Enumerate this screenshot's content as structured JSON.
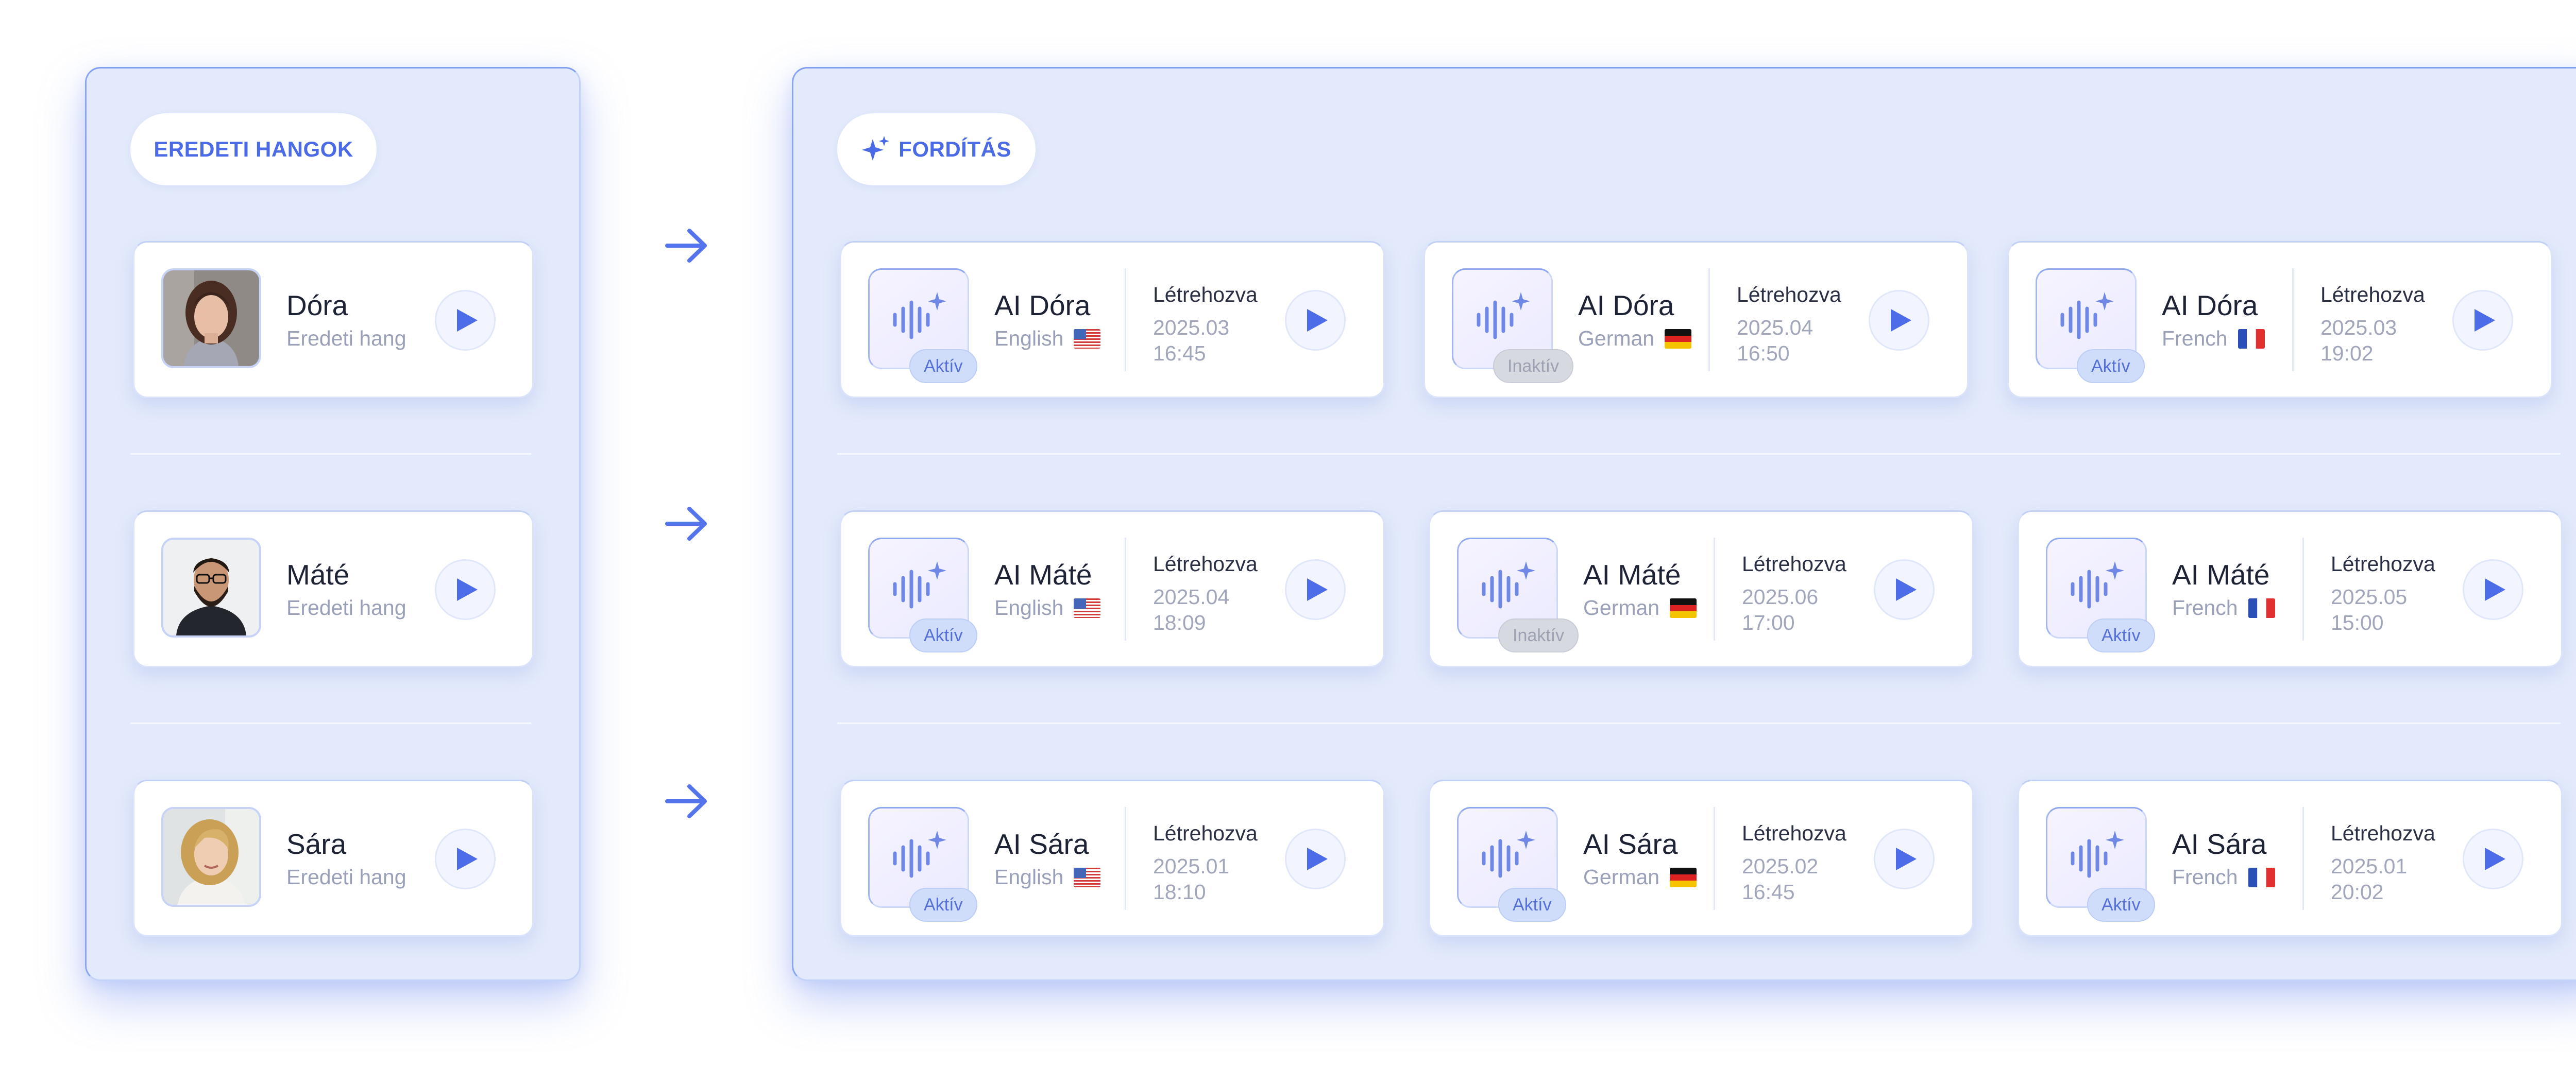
{
  "left_panel": {
    "heading": "EREDETI HANGOK",
    "voices": [
      {
        "name": "Dóra",
        "subtitle": "Eredeti hang"
      },
      {
        "name": "Máté",
        "subtitle": "Eredeti hang"
      },
      {
        "name": "Sára",
        "subtitle": "Eredeti hang"
      }
    ]
  },
  "right_panel": {
    "heading": "FORDÍTÁS",
    "created_label": "Létrehozva",
    "rows": [
      [
        {
          "name": "AI Dóra",
          "language": "English",
          "flag": "us",
          "date": "2025.03",
          "time": "16:45",
          "status": "Aktív"
        },
        {
          "name": "AI Dóra",
          "language": "German",
          "flag": "de",
          "date": "2025.04",
          "time": "16:50",
          "status": "Inaktív"
        },
        {
          "name": "AI Dóra",
          "language": "French",
          "flag": "fr",
          "date": "2025.03",
          "time": "19:02",
          "status": "Aktív"
        }
      ],
      [
        {
          "name": "AI Máté",
          "language": "English",
          "flag": "us",
          "date": "2025.04",
          "time": "18:09",
          "status": "Aktív"
        },
        {
          "name": "AI Máté",
          "language": "German",
          "flag": "de",
          "date": "2025.06",
          "time": "17:00",
          "status": "Inaktív"
        },
        {
          "name": "AI Máté",
          "language": "French",
          "flag": "fr",
          "date": "2025.05",
          "time": "15:00",
          "status": "Aktív"
        }
      ],
      [
        {
          "name": "AI Sára",
          "language": "English",
          "flag": "us",
          "date": "2025.01",
          "time": "18:10",
          "status": "Aktív"
        },
        {
          "name": "AI Sára",
          "language": "German",
          "flag": "de",
          "date": "2025.02",
          "time": "16:45",
          "status": "Aktív"
        },
        {
          "name": "AI Sára",
          "language": "French",
          "flag": "fr",
          "date": "2025.01",
          "time": "20:02",
          "status": "Aktív"
        }
      ]
    ]
  },
  "icons": {
    "play": "play-icon",
    "arrow": "arrow-right-icon",
    "sparkle": "sparkle-icon",
    "voice": "ai-voice-waveform-icon"
  },
  "colors": {
    "accent": "#4a6ae6",
    "panel_bg": "#e3eafb",
    "active_badge": "#cfdcfa",
    "inactive_badge": "#d7d9e1"
  }
}
